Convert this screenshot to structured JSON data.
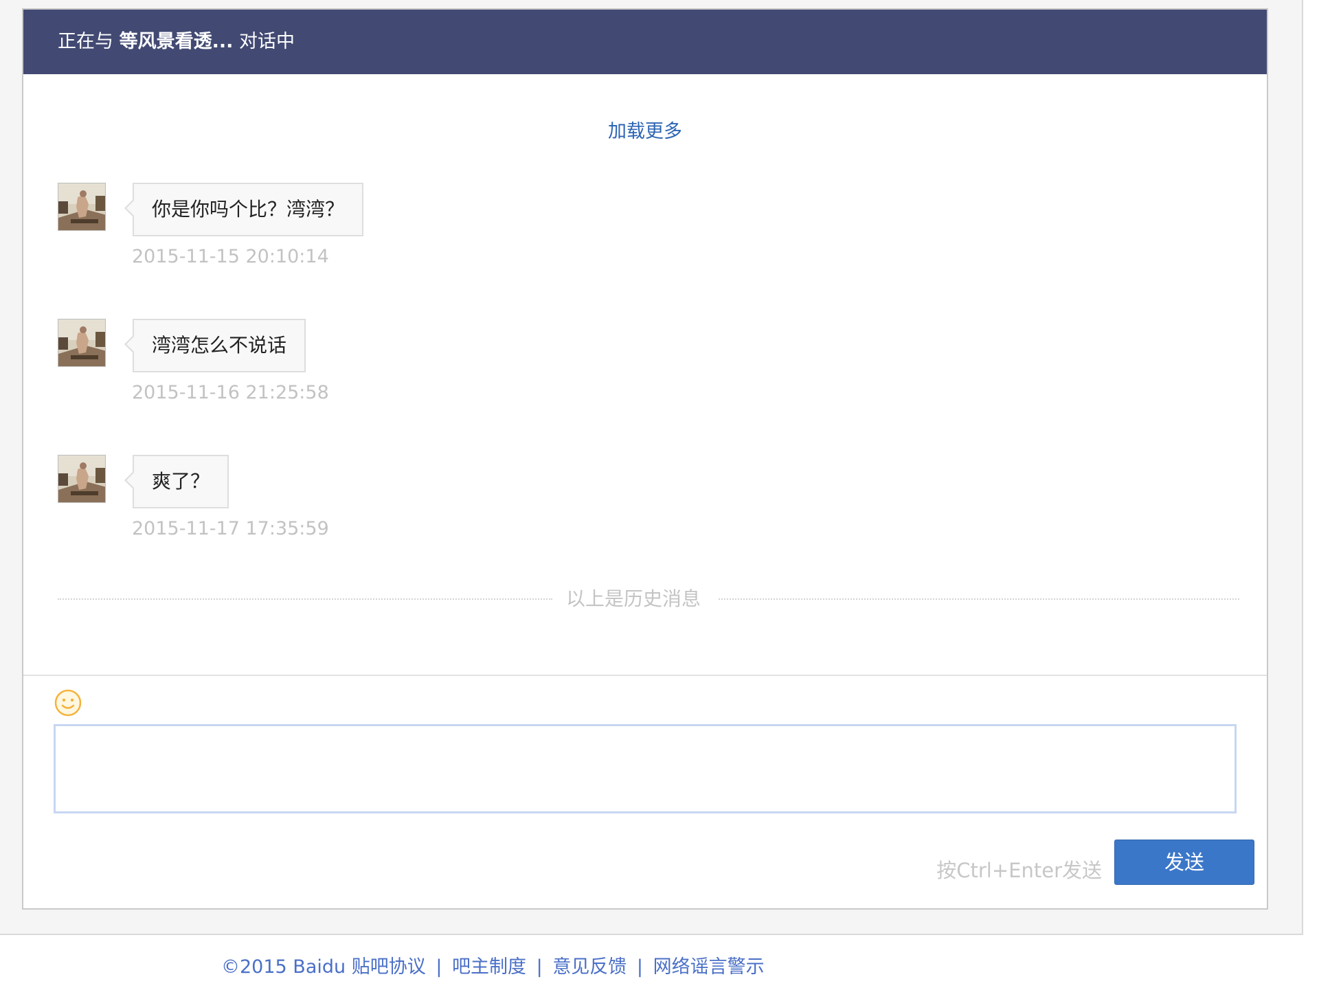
{
  "header": {
    "prefix": "正在与 ",
    "partner_name": "等风景看透...",
    "suffix": " 对话中"
  },
  "load_more": "加载更多",
  "messages": [
    {
      "text": "你是你吗个比？湾湾？",
      "time": "2015-11-15 20:10:14"
    },
    {
      "text": "湾湾怎么不说话",
      "time": "2015-11-16 21:25:58"
    },
    {
      "text": "爽了？",
      "time": "2015-11-17 17:35:59"
    }
  ],
  "history_label": "以上是历史消息",
  "composer": {
    "emoji_icon": "smiley-icon",
    "input_value": "",
    "hint": "按Ctrl+Enter发送",
    "send_label": "发送"
  },
  "footer": {
    "copyright": "©2015 Baidu",
    "links": [
      "贴吧协议",
      "吧主制度",
      "意见反馈",
      "网络谣言警示"
    ],
    "separator": "|"
  },
  "colors": {
    "header_bg": "#424a73",
    "link": "#2d64b3",
    "send_button": "#3b77c9",
    "emoji": "#f3b33d"
  }
}
